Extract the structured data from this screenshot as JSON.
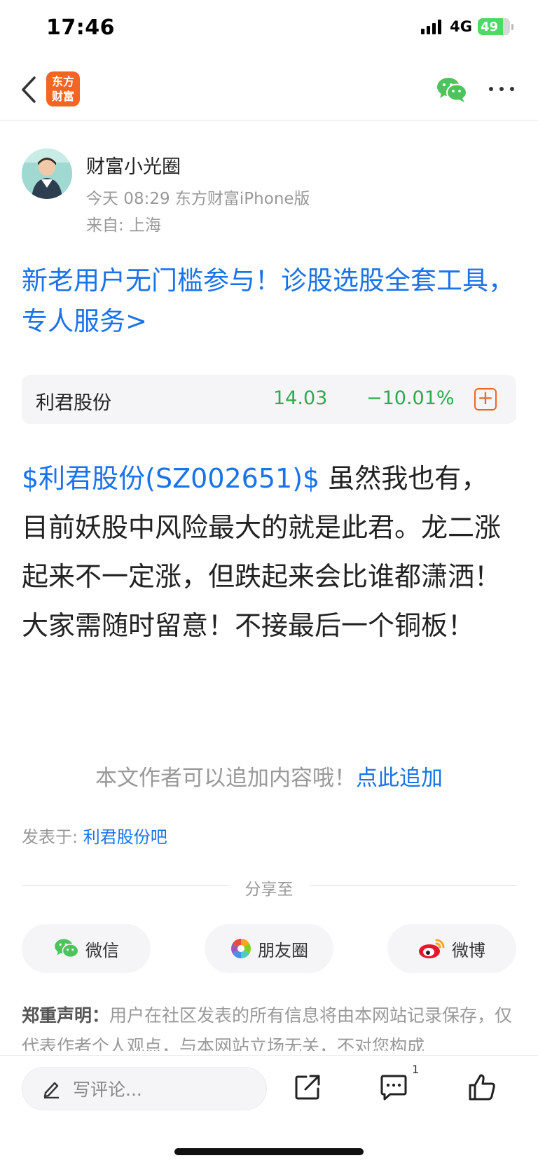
{
  "status_bar": {
    "time": "17:46",
    "network": "4G",
    "battery": "49"
  },
  "nav": {
    "logo_line1": "东方",
    "logo_line2": "财富"
  },
  "author": {
    "name": "财富小光圈",
    "meta": "今天 08:29 东方财富iPhone版",
    "location": "来自: 上海"
  },
  "promo": {
    "text": "新老用户无门槛参与！诊股选股全套工具，专人服务>"
  },
  "stock": {
    "name": "利君股份",
    "price": "14.03",
    "change": "−10.01%",
    "add_symbol": "+"
  },
  "post": {
    "stock_link": "$利君股份(SZ002651)$",
    "text": "  虽然我也有，目前妖股中风险最大的就是此君。龙二涨起来不一定涨，但跌起来会比谁都潇洒！大家需随时留意！不接最后一个铜板！"
  },
  "append": {
    "prompt": "本文作者可以追加内容哦！",
    "link": "点此追加"
  },
  "published": {
    "label": "发表于: ",
    "forum": "利君股份吧"
  },
  "share": {
    "title": "分享至",
    "buttons": [
      {
        "label": "微信",
        "icon": "wechat-icon"
      },
      {
        "label": "朋友圈",
        "icon": "moments-icon"
      },
      {
        "label": "微博",
        "icon": "weibo-icon"
      }
    ]
  },
  "disclaimer": {
    "title": "郑重声明：",
    "text": "用户在社区发表的所有信息将由本网站记录保存，仅代表作者个人观点，与本网站立场无关，不对您构成"
  },
  "bottom": {
    "comment_placeholder": "写评论...",
    "comment_count": "1"
  },
  "colors": {
    "link": "#1a73e8",
    "stock_down": "#2fa84f",
    "brand": "#f26522"
  }
}
